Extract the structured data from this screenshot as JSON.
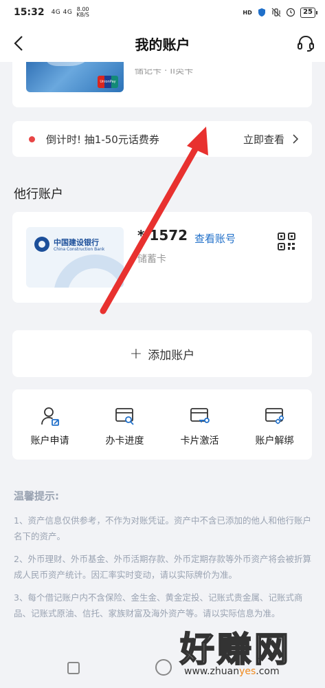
{
  "status_bar": {
    "time": "15:32",
    "signal": "4G 4G",
    "speed_value": "8.00",
    "speed_unit": "KB/S",
    "hd_label": "HD",
    "battery": "25"
  },
  "nav": {
    "title": "我的账户"
  },
  "top_card": {
    "partial_text": "储记卡 · II类卡",
    "unionpay_label": "UnionPay"
  },
  "promo": {
    "text": "倒计时! 抽1-50元话费券",
    "link": "立即查看"
  },
  "other_accounts": {
    "section_title": "他行账户",
    "bank_name": "中国建设银行",
    "bank_name_en": "China Construction Bank",
    "card_number": "* 1572",
    "view_link": "查看账号",
    "card_type": "储蓄卡"
  },
  "add_account": {
    "plus": "+",
    "label": "添加账户"
  },
  "actions": [
    {
      "label": "账户申请",
      "icon": "user-edit-icon"
    },
    {
      "label": "办卡进度",
      "icon": "card-search-icon"
    },
    {
      "label": "卡片激活",
      "icon": "card-key-icon"
    },
    {
      "label": "账户解绑",
      "icon": "card-unlink-icon"
    }
  ],
  "tips": {
    "title": "温馨提示:",
    "items": [
      "1、资产信息仅供参考，不作为对账凭证。资产中不含已添加的他人和他行账户名下的资产。",
      "2、外币理财、外币基金、外币活期存款、外币定期存款等外币资产将会被折算成人民币资产统计。因汇率实时变动，请以实际牌价为准。",
      "3、每个借记账户内不含保险、金生金、黄金定投、记账式贵金属、记账式商品、记账式原油、信托、家族财富及海外资产等。请以实际信息为准。"
    ]
  },
  "watermark": {
    "big": "好赚网",
    "small_prefix": "www.zhuan",
    "small_highlight": "yes",
    "small_suffix": ".com"
  },
  "colors": {
    "accent_blue": "#1f6fc9",
    "promo_dot": "#e84545",
    "arrow": "#e8312f"
  }
}
